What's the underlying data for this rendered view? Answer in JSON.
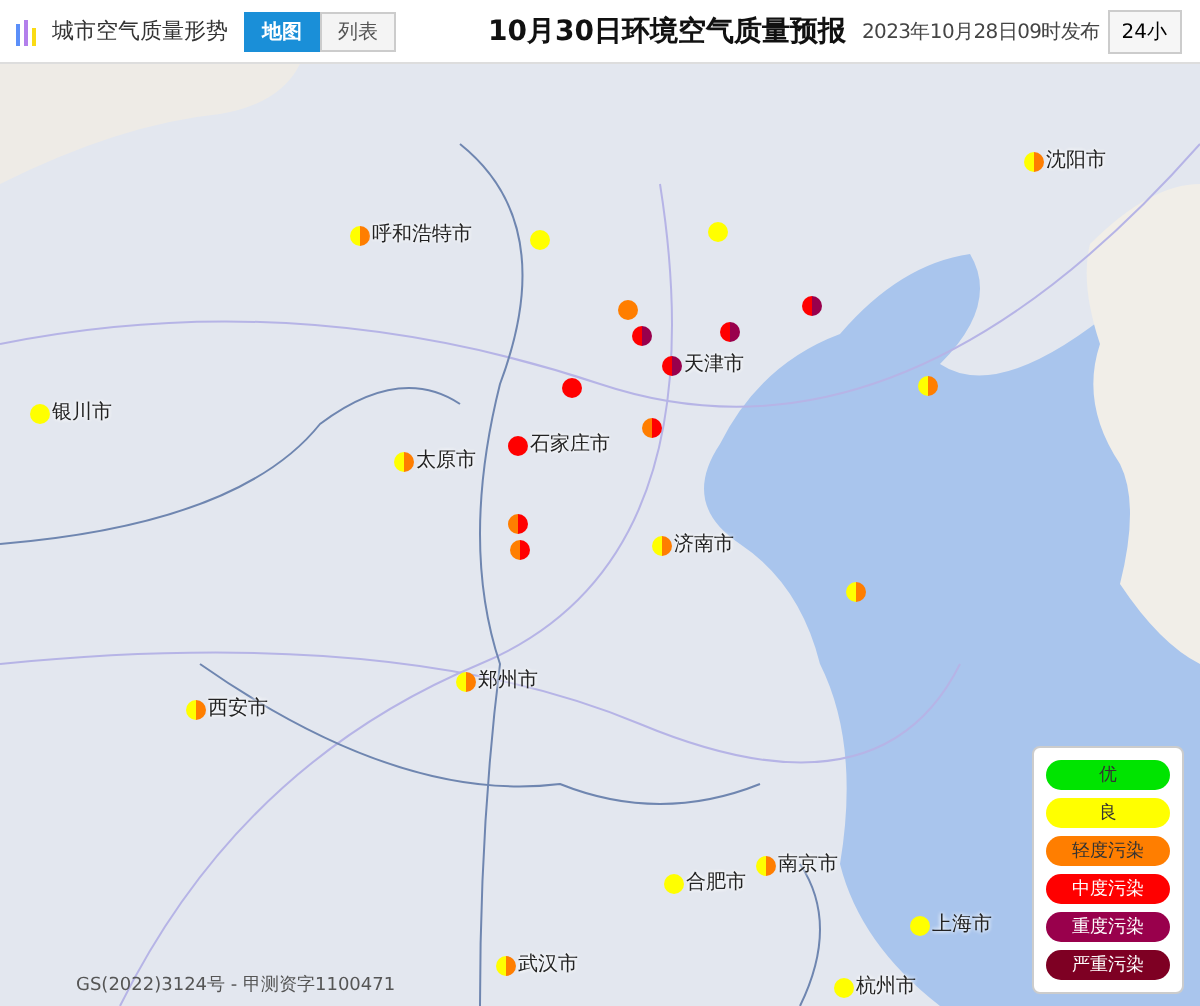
{
  "header": {
    "section_title": "城市空气质量形势",
    "view_tabs": [
      {
        "label": "地图",
        "selected": true
      },
      {
        "label": "列表",
        "selected": false
      }
    ],
    "title": "10月30日环境空气质量预报",
    "published": "2023年10月28日09时发布",
    "period_button": "24小"
  },
  "map": {
    "markers": [
      {
        "label": "呼和浩特市",
        "halves": [
          {
            "color": "#ffff00"
          },
          {
            "color": "#ff7e00"
          }
        ]
      },
      {
        "halves": [
          {
            "color": "#ffff00"
          },
          {
            "color": "#ffff00"
          }
        ]
      },
      {
        "label": "银川市",
        "halves": [
          {
            "color": "#ffff00"
          },
          {
            "color": "#ffff00"
          }
        ]
      },
      {
        "label": "太原市",
        "halves": [
          {
            "color": "#ffff00"
          },
          {
            "color": "#ff7e00"
          }
        ]
      },
      {
        "halves": [
          {
            "color": "#ff0000"
          },
          {
            "color": "#ff0000"
          }
        ]
      },
      {
        "label": "石家庄市",
        "halves": [
          {
            "color": "#ff0000"
          },
          {
            "color": "#ff0000"
          }
        ]
      },
      {
        "halves": [
          {
            "color": "#ff7e00"
          },
          {
            "color": "#ff0000"
          }
        ]
      },
      {
        "halves": [
          {
            "color": "#ff7e00"
          },
          {
            "color": "#ff0000"
          }
        ]
      },
      {
        "halves": [
          {
            "color": "#ff7e00"
          },
          {
            "color": "#ff0000"
          }
        ]
      },
      {
        "halves": [
          {
            "color": "#ff7e00"
          },
          {
            "color": "#ff7e00"
          }
        ]
      },
      {
        "halves": [
          {
            "color": "#ff0000"
          },
          {
            "color": "#99004c"
          }
        ]
      },
      {
        "label": "天津市",
        "halves": [
          {
            "color": "#ff0000"
          },
          {
            "color": "#99004c"
          }
        ]
      },
      {
        "halves": [
          {
            "color": "#ff0000"
          },
          {
            "color": "#99004c"
          }
        ]
      },
      {
        "halves": [
          {
            "color": "#ff0000"
          },
          {
            "color": "#99004c"
          }
        ]
      },
      {
        "halves": [
          {
            "color": "#ffff00"
          },
          {
            "color": "#ffff00"
          }
        ]
      },
      {
        "label": "沈阳市",
        "halves": [
          {
            "color": "#ffff00"
          },
          {
            "color": "#ff7e00"
          }
        ]
      },
      {
        "halves": [
          {
            "color": "#ffff00"
          },
          {
            "color": "#ff7e00"
          }
        ]
      },
      {
        "label": "济南市",
        "halves": [
          {
            "color": "#ffff00"
          },
          {
            "color": "#ff7e00"
          }
        ]
      },
      {
        "halves": [
          {
            "color": "#ffff00"
          },
          {
            "color": "#ff7e00"
          }
        ]
      },
      {
        "label": "西安市",
        "halves": [
          {
            "color": "#ffff00"
          },
          {
            "color": "#ff7e00"
          }
        ]
      },
      {
        "label": "郑州市",
        "halves": [
          {
            "color": "#ffff00"
          },
          {
            "color": "#ff7e00"
          }
        ]
      },
      {
        "label": "武汉市",
        "halves": [
          {
            "color": "#ffff00"
          },
          {
            "color": "#ff7e00"
          }
        ]
      },
      {
        "label": "合肥市",
        "halves": [
          {
            "color": "#ffff00"
          },
          {
            "color": "#ffff00"
          }
        ]
      },
      {
        "label": "南京市",
        "halves": [
          {
            "color": "#ffff00"
          },
          {
            "color": "#ff7e00"
          }
        ]
      },
      {
        "label": "上海市",
        "halves": [
          {
            "color": "#ffff00"
          },
          {
            "color": "#ffff00"
          }
        ]
      },
      {
        "label": "杭州市",
        "halves": [
          {
            "color": "#ffff00"
          },
          {
            "color": "#ffff00"
          }
        ]
      }
    ],
    "legend": [
      {
        "label": "优",
        "color": "#00e400"
      },
      {
        "label": "良",
        "color": "#ffff00"
      },
      {
        "label": "轻度污染",
        "color": "#ff7e00"
      },
      {
        "label": "中度污染",
        "color": "#ff0000"
      },
      {
        "label": "重度污染",
        "color": "#99004c"
      },
      {
        "label": "严重污染",
        "color": "#7e0023"
      }
    ],
    "attribution": "GS(2022)3124号 - 甲测资字1100471"
  }
}
